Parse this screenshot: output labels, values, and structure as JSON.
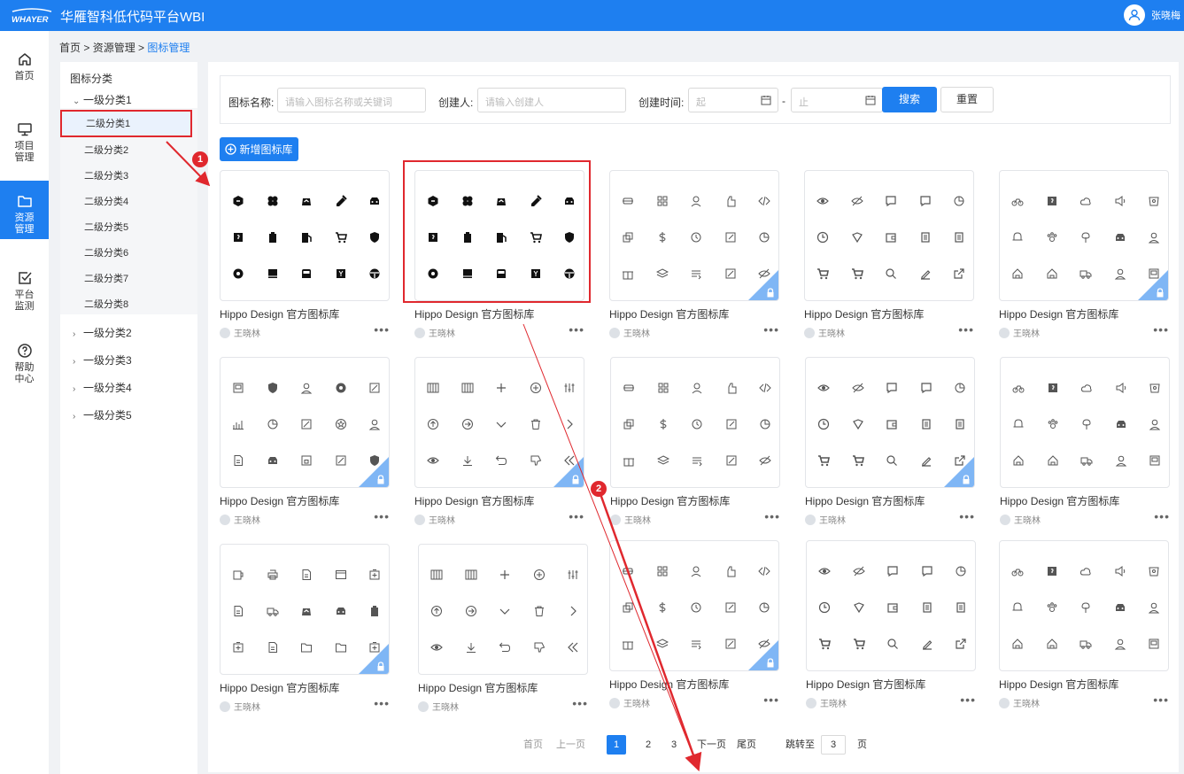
{
  "header": {
    "app_title": "华雁智科低代码平台WBI",
    "user_name": "张晓梅",
    "logo_text": "WHAYER"
  },
  "sidenav": [
    {
      "icon": "home-icon",
      "label": "首页"
    },
    {
      "icon": "monitor-icon",
      "label": "项目\n管理"
    },
    {
      "icon": "folder-icon",
      "label": "资源\n管理",
      "active": true
    },
    {
      "icon": "checkbox-icon",
      "label": "平台\n监测"
    },
    {
      "icon": "help-icon",
      "label": "帮助\n中心"
    }
  ],
  "breadcrumb": {
    "home": "首页",
    "sep1": " > ",
    "section": "资源管理",
    "sep2": " > ",
    "current": "图标管理"
  },
  "categories": {
    "title": "图标分类",
    "level1": [
      "一级分类1",
      "一级分类2",
      "一级分类3",
      "一级分类4",
      "一级分类5"
    ],
    "level2": [
      "二级分类1",
      "二级分类2",
      "二级分类3",
      "二级分类4",
      "二级分类5",
      "二级分类6",
      "二级分类7",
      "二级分类8"
    ],
    "selected": "二级分类1"
  },
  "filter": {
    "name_label": "图标名称:",
    "name_placeholder": "请输入图标名称或关键词",
    "creator_label": "创建人:",
    "creator_placeholder": "请输入创建人",
    "time_label": "创建时间:",
    "start_placeholder": "起",
    "range_sep": "-",
    "end_placeholder": "止",
    "search_label": "搜索",
    "reset_label": "重置"
  },
  "new_button_label": "新增图标库",
  "cards": [
    {
      "name": "Hippo Design 官方图标库",
      "author": "王晓林",
      "set": "A",
      "locked": false
    },
    {
      "name": "Hippo Design 官方图标库",
      "author": "王晓林",
      "set": "A",
      "locked": false
    },
    {
      "name": "Hippo Design 官方图标库",
      "author": "王晓林",
      "set": "B",
      "locked": true
    },
    {
      "name": "Hippo Design 官方图标库",
      "author": "王晓林",
      "set": "C",
      "locked": false
    },
    {
      "name": "Hippo Design 官方图标库",
      "author": "王晓林",
      "set": "D",
      "locked": true
    },
    {
      "name": "Hippo Design 官方图标库",
      "author": "王晓林",
      "set": "E",
      "locked": true
    },
    {
      "name": "Hippo Design 官方图标库",
      "author": "王晓林",
      "set": "F",
      "locked": true
    },
    {
      "name": "Hippo Design 官方图标库",
      "author": "王晓林",
      "set": "B",
      "locked": false
    },
    {
      "name": "Hippo Design 官方图标库",
      "author": "王晓林",
      "set": "C",
      "locked": true
    },
    {
      "name": "Hippo Design 官方图标库",
      "author": "王晓林",
      "set": "D",
      "locked": false
    },
    {
      "name": "Hippo Design 官方图标库",
      "author": "王晓林",
      "set": "G",
      "locked": true
    },
    {
      "name": "Hippo Design 官方图标库",
      "author": "王晓林",
      "set": "F",
      "locked": false
    },
    {
      "name": "Hippo Design 官方图标库",
      "author": "王晓林",
      "set": "B",
      "locked": true
    },
    {
      "name": "Hippo Design 官方图标库",
      "author": "王晓林",
      "set": "C",
      "locked": false
    },
    {
      "name": "Hippo Design 官方图标库",
      "author": "王晓林",
      "set": "D",
      "locked": false
    }
  ],
  "pagination": {
    "first": "首页",
    "prev": "上一页",
    "pages": [
      "1",
      "2",
      "3"
    ],
    "current": "1",
    "next": "下一页",
    "last": "尾页",
    "jump_label": "跳转至",
    "jump_value": "3",
    "page_unit": "页"
  },
  "annotations": [
    "1",
    "2"
  ],
  "colors": {
    "primary": "#1e7ff0",
    "highlight": "#e0282e",
    "lock": "#7fb6f5"
  }
}
